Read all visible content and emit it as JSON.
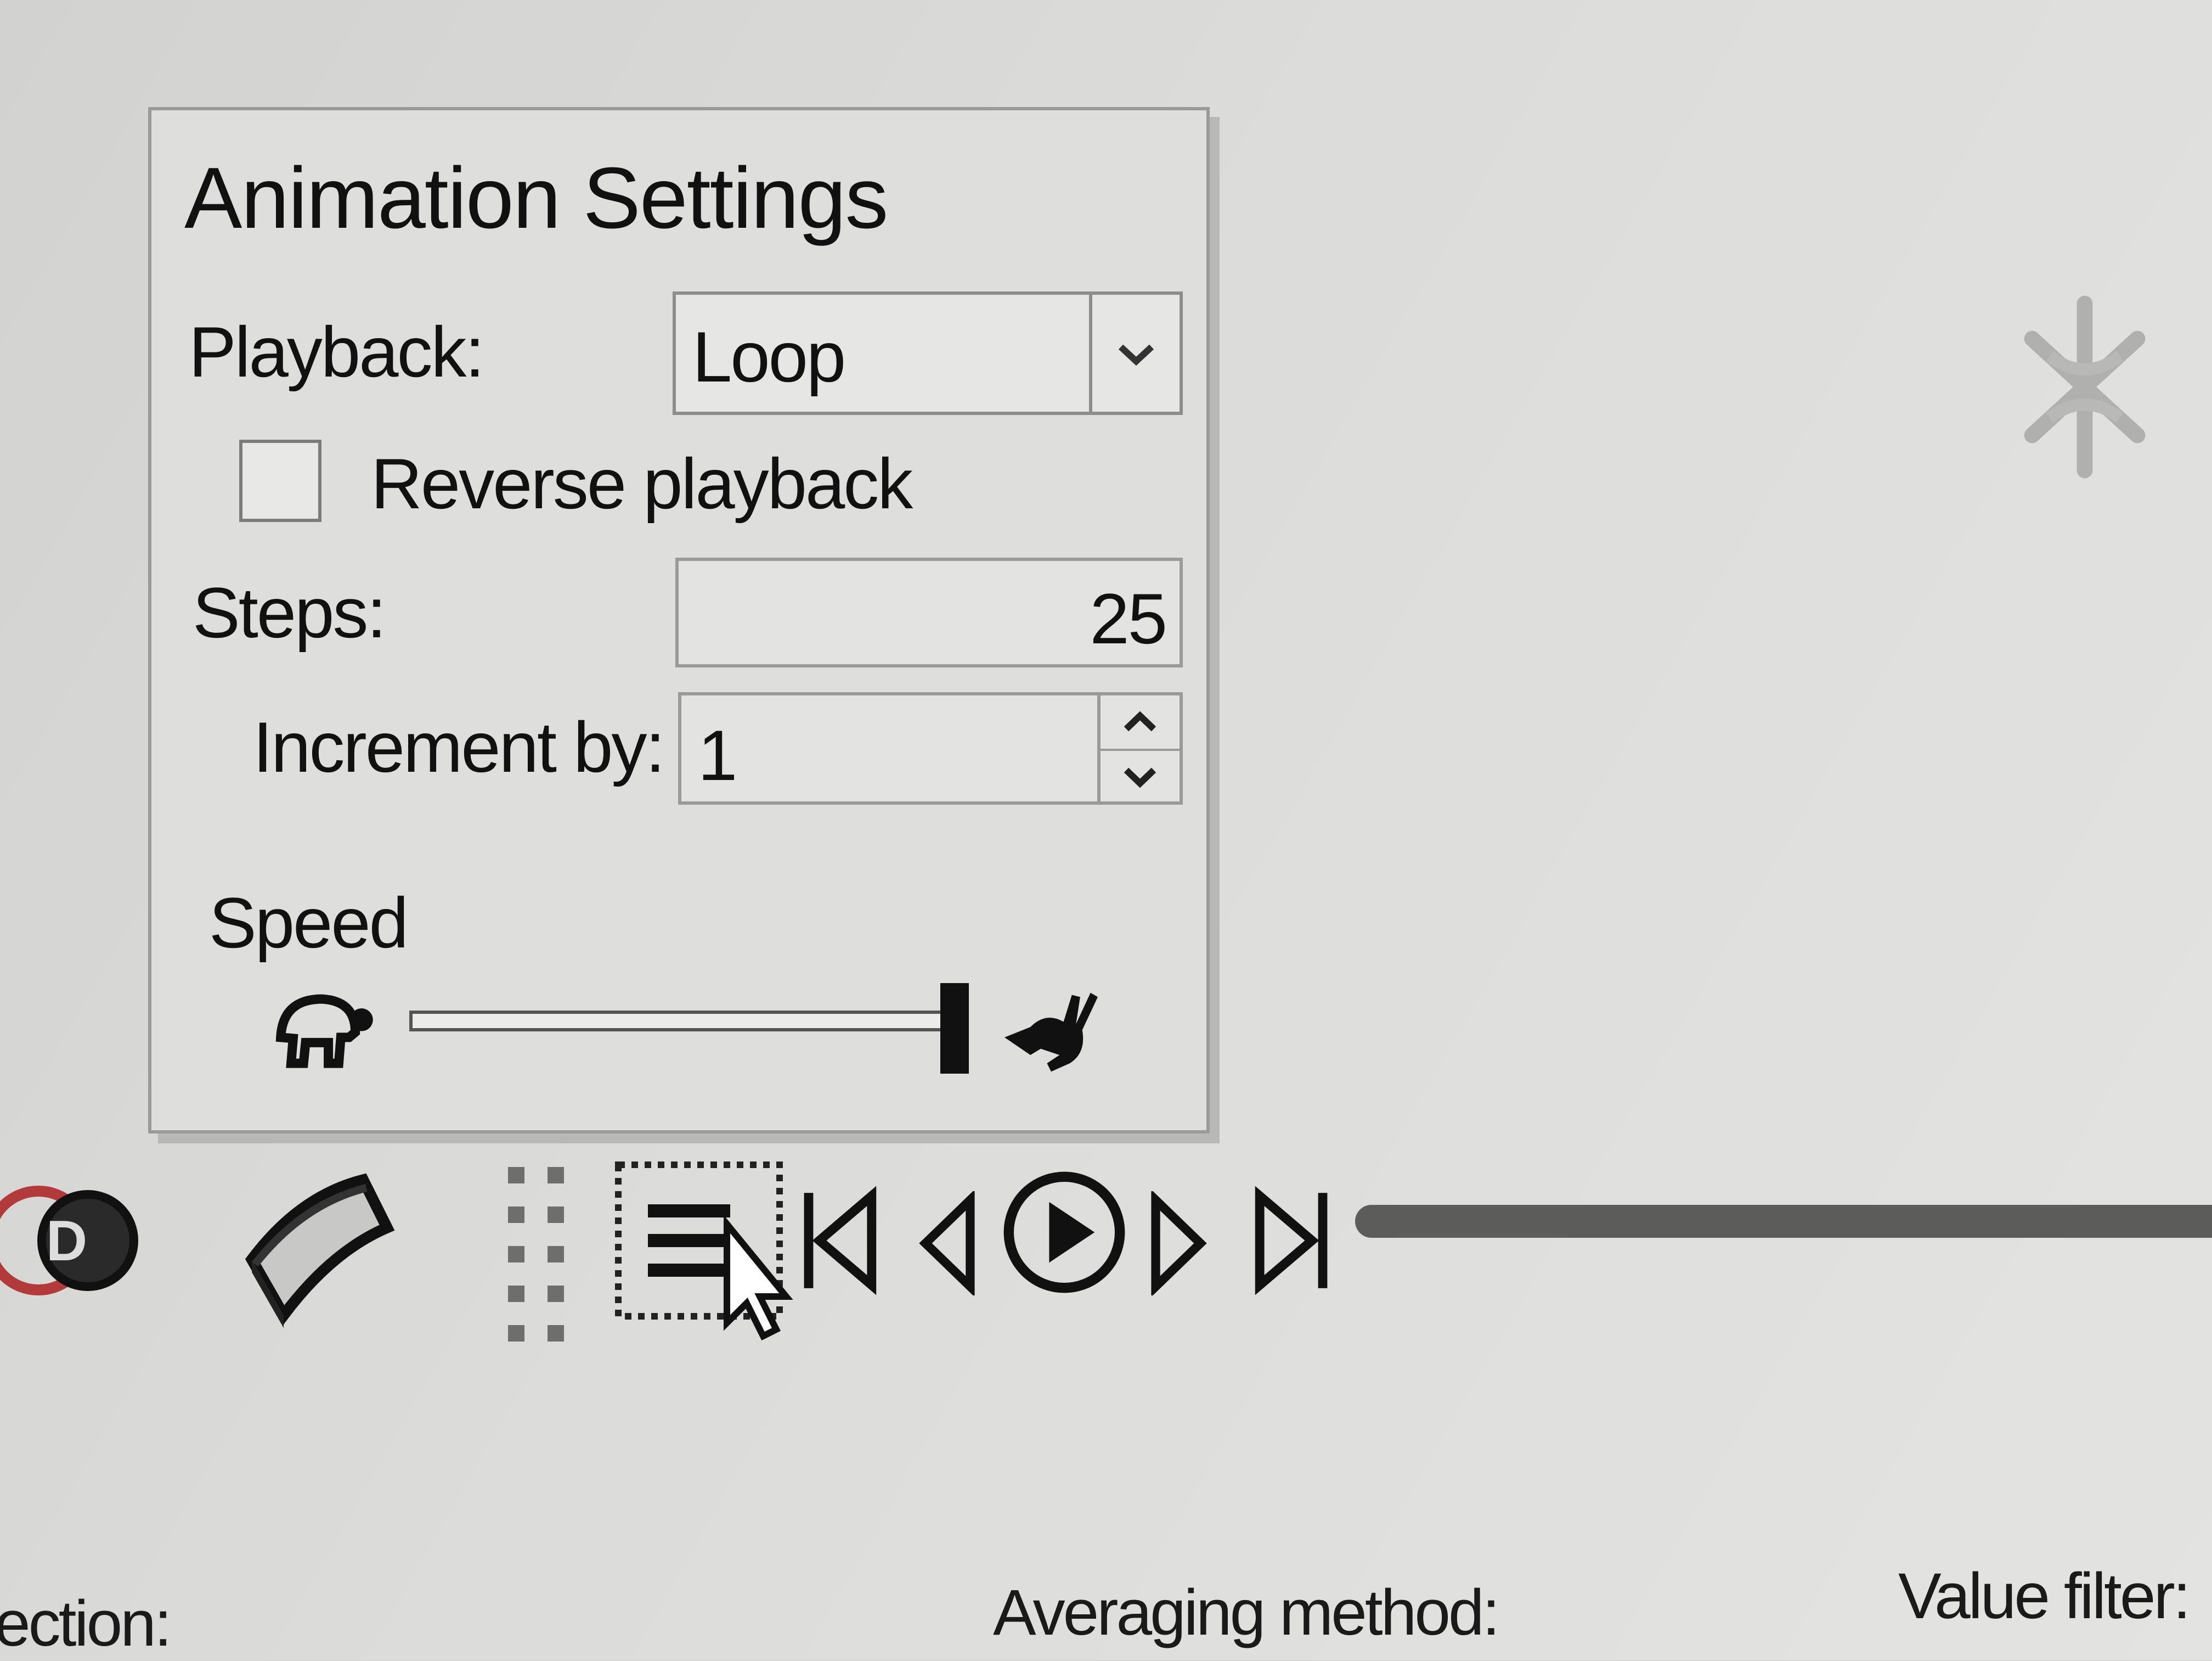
{
  "popup": {
    "title": "Animation Settings",
    "playback_label": "Playback:",
    "playback_value": "Loop",
    "reverse_label": "Reverse playback",
    "reverse_checked": false,
    "steps_label": "Steps:",
    "steps_value": "25",
    "increment_label": "Increment by:",
    "increment_value": "1",
    "speed_label": "Speed",
    "speed_level": 1.0
  },
  "toolbar": {
    "icons": [
      "3d-glasses-icon",
      "tube-shape-icon",
      "grip-handle-icon",
      "animation-settings-icon",
      "skip-to-start-icon",
      "step-back-icon",
      "play-icon",
      "step-forward-icon",
      "skip-to-end-icon"
    ]
  },
  "status": {
    "direction_label": "ection:",
    "averaging_label": "Averaging method:",
    "value_filter_label": "Value filter:"
  },
  "colors": {
    "background": "#d6d6d4",
    "panel": "#dededc",
    "text": "#111111",
    "glasses_accent": "#b33a3a"
  }
}
